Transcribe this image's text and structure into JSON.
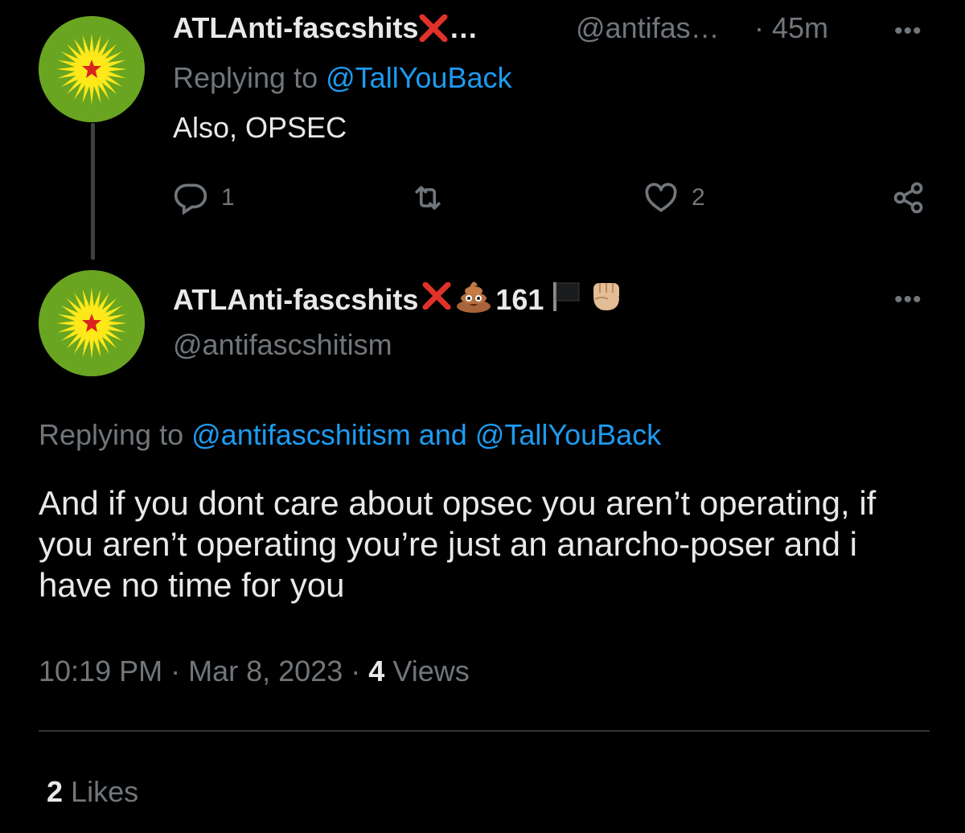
{
  "parent": {
    "display_name": "ATLAnti-fascshits",
    "name_ellipsis": "…",
    "handle": "@antifas…",
    "time": "· 45m",
    "more_label": "•••",
    "replying_prefix": "Replying to",
    "replying_to": "@TallYouBack",
    "text": "Also, OPSEC",
    "actions": {
      "replies": "1",
      "retweets": "",
      "likes": "2"
    }
  },
  "main": {
    "display_name": "ATLAnti-fascshits",
    "name_number": "161",
    "handle": "@antifascshitism",
    "more_label": "•••",
    "replying_prefix": "Replying to",
    "replying_to": "@antifascshitism and @TallYouBack",
    "text": "And if you dont care about opsec you aren’t operating, if you aren’t operating you’re just an anarcho-poser and i have no time for you",
    "time": "10:19 PM",
    "date": "Mar 8, 2023",
    "views_count": "4",
    "views_label": "Views",
    "likes_count": "2",
    "likes_label": "Likes"
  },
  "colors": {
    "background": "#000000",
    "text": "#e7e9ea",
    "muted": "#71767b",
    "link": "#1d9bf0",
    "avatar_green": "#6aa521",
    "sun_yellow": "#ffe81a",
    "star_red": "#d9261c"
  },
  "icons": [
    "reply-icon",
    "retweet-icon",
    "like-icon",
    "share-icon",
    "red-x-emoji",
    "poop-emoji",
    "black-flag-emoji",
    "raised-fist-emoji"
  ]
}
